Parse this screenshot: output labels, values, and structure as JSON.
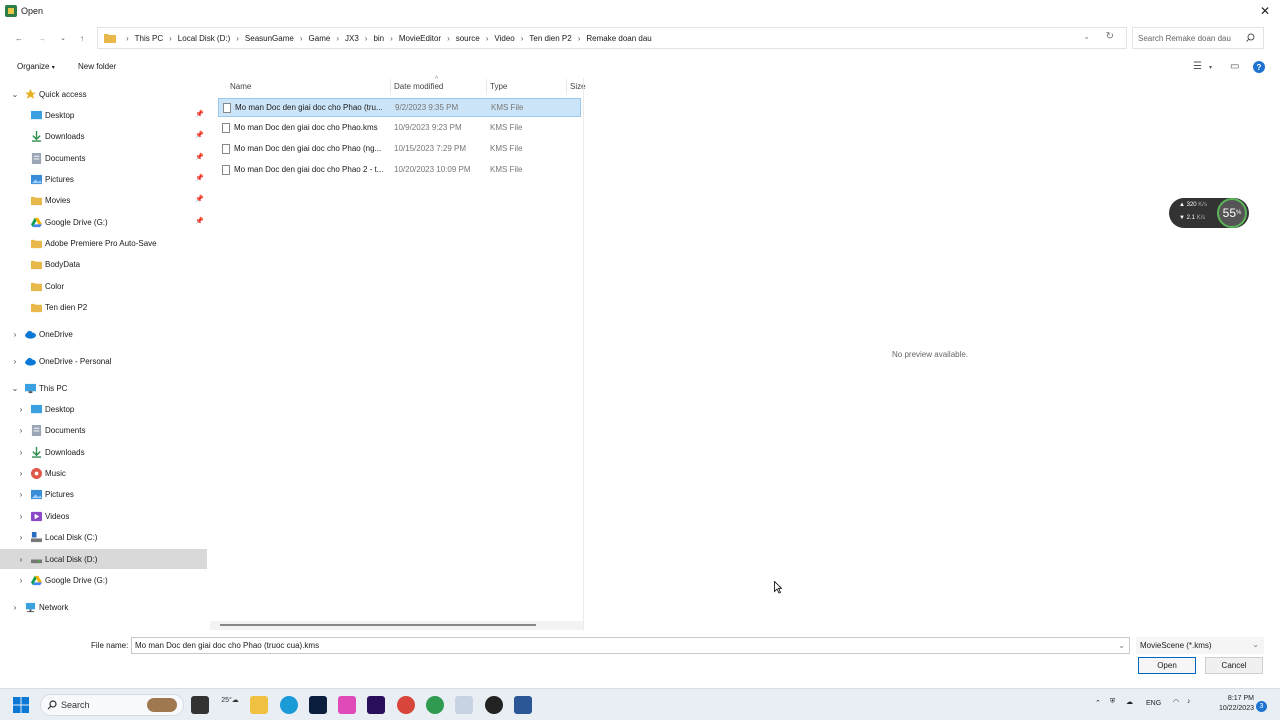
{
  "window": {
    "title": "Open"
  },
  "address": {
    "crumbs": [
      "This PC",
      "Local Disk (D:)",
      "SeasunGame",
      "Game",
      "JX3",
      "bin",
      "MovieEditor",
      "source",
      "Video",
      "Ten dien P2",
      "Remake doan dau"
    ]
  },
  "search": {
    "placeholder": "Search Remake doan dau"
  },
  "toolbar": {
    "organize": "Organize",
    "new_folder": "New folder"
  },
  "nav": {
    "quick_access": "Quick access",
    "quick_items": [
      "Desktop",
      "Downloads",
      "Documents",
      "Pictures",
      "Movies",
      "Google Drive (G:)",
      "Adobe Premiere Pro Auto-Save",
      "BodyData",
      "Color",
      "Ten dien P2"
    ],
    "onedrive": "OneDrive",
    "onedrive_personal": "OneDrive - Personal",
    "this_pc": "This PC",
    "pc_items": [
      "Desktop",
      "Documents",
      "Downloads",
      "Music",
      "Pictures",
      "Videos",
      "Local Disk (C:)",
      "Local Disk (D:)",
      "Google Drive (G:)"
    ],
    "network": "Network"
  },
  "columns": {
    "name": "Name",
    "date": "Date modified",
    "type": "Type",
    "size": "Size"
  },
  "files": [
    {
      "name": "Mo man Doc den giai doc cho Phao (tru...",
      "date": "9/2/2023 9:35 PM",
      "type": "KMS File"
    },
    {
      "name": "Mo man Doc den giai doc cho Phao.kms",
      "date": "10/9/2023 9:23 PM",
      "type": "KMS File"
    },
    {
      "name": "Mo man Doc den giai doc cho Phao (ng...",
      "date": "10/15/2023 7:29 PM",
      "type": "KMS File"
    },
    {
      "name": "Mo man Doc den giai doc cho Phao 2 - t...",
      "date": "10/20/2023 10:09 PM",
      "type": "KMS File"
    }
  ],
  "preview": {
    "text": "No preview available."
  },
  "meter": {
    "up": "320",
    "up_unit": "K/s",
    "down": "2.1",
    "down_unit": "K/s",
    "percent": "55",
    "percent_unit": "%"
  },
  "bottom": {
    "file_name_label": "File name:",
    "file_name_value": "Mo man Doc den giai doc cho Phao (truoc cua).kms",
    "file_type": "MovieScene (*.kms)",
    "open": "Open",
    "cancel": "Cancel"
  },
  "taskbar": {
    "search": "Search",
    "weather_temp": "25°",
    "lang": "ENG",
    "time": "8:17 PM",
    "date": "10/22/2023",
    "notifications": "3"
  },
  "colors": {
    "accent": "#0067c0",
    "selection": "#cce4f7",
    "nav_selected": "#d9d9d9"
  }
}
